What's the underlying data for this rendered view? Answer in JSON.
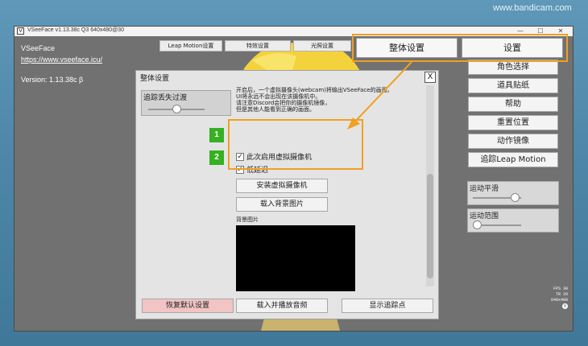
{
  "watermark": "www.bandicam.com",
  "window": {
    "title": "VSeeFace v1.13.38c Q3 640x480@30",
    "logo": "V",
    "controls": {
      "minimize": "—",
      "maximize": "☐",
      "close": "✕"
    }
  },
  "info": {
    "app_name": "VSeeFace",
    "url": "https://www.vseeface.icu/",
    "version": "Version: 1.13.38c β"
  },
  "top_buttons": [
    "Leap Motion设置",
    "特效设置",
    "光照设置"
  ],
  "right_panel": {
    "general_settings": "整体设置",
    "settings": "设置",
    "buttons": [
      "角色选择",
      "道具贴纸",
      "帮助",
      "重置位置",
      "动作镜像",
      "追踪Leap Motion"
    ],
    "motion_smoothing": "运动平滑",
    "motion_range": "运动范围"
  },
  "stats": {
    "fps": "FPS 30",
    "tr": "TR 29",
    "res": "640x480"
  },
  "dialog": {
    "title": "整体设置",
    "close": "X",
    "tracking_loss": "追踪丢失过渡",
    "warning_lines": [
      "开启后，一个虚拟摄像头(webcam)将输出VSeeFace的画面。",
      "UI将永远不会出现在该摄像机中。",
      "请注意Discord会把你的摄像机镜像，",
      "但是其他人能看到正确的画面。"
    ],
    "checkbox_enable_camera": "此次启用虚拟摄像机",
    "checkbox_low_latency": "低延迟",
    "install_camera": "安装虚拟摄像机",
    "load_background": "载入背景图片",
    "background_label": "背景图片",
    "reset_defaults": "恢复默认设置",
    "load_audio": "载入并播放音频",
    "show_tracking": "显示追踪点"
  },
  "annotations": {
    "step1": "1",
    "step2": "2",
    "accent": "#f0a023",
    "badge_color": "#37b022"
  }
}
